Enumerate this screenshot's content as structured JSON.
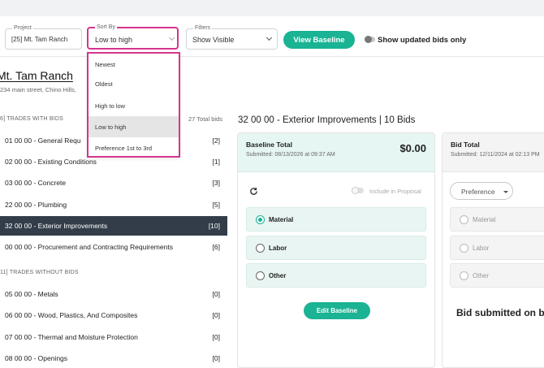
{
  "toolbar": {
    "project": {
      "legend": "Project",
      "value": "[25] Mt. Tam Ranch"
    },
    "sort_by": {
      "legend": "Sort By",
      "value": "Low to high"
    },
    "filters": {
      "legend": "Filters",
      "value": "Show Visible"
    },
    "view_baseline_label": "View Baseline",
    "show_updated_label": "Show updated bids only"
  },
  "sort_dropdown": {
    "options": [
      "Newest",
      "Oldest",
      "High to low",
      "Low to high",
      "Preference 1st to 3rd"
    ],
    "selected": "Low to high"
  },
  "project": {
    "title": "Mt. Tam Ranch",
    "address": "234 main street, Chino Hills,"
  },
  "sidebar": {
    "with_bids_heading": "6] TRADES WITH BIDS",
    "total_bids": "27 Total bids",
    "with_bids": [
      {
        "name": "01 00 00 - General Requ",
        "count": "[2]"
      },
      {
        "name": "02 00 00 - Existing Conditions",
        "count": "[1]"
      },
      {
        "name": "03 00 00 - Concrete",
        "count": "[3]"
      },
      {
        "name": "22 00 00 - Plumbing",
        "count": "[5]"
      },
      {
        "name": "32 00 00 - Exterior Improvements",
        "count": "[10]"
      },
      {
        "name": "00 00 00 - Procurement and Contracting Requirements",
        "count": "[6]"
      }
    ],
    "without_bids_heading": "11] TRADES WITHOUT BIDS",
    "without_bids": [
      {
        "name": "05 00 00 - Metals",
        "count": "[0]"
      },
      {
        "name": "06 00 00 - Wood, Plastics, And Composites",
        "count": "[0]"
      },
      {
        "name": "07 00 00 - Thermal and Moisture Protection",
        "count": "[0]"
      },
      {
        "name": "08 00 00 - Openings",
        "count": "[0]"
      }
    ]
  },
  "main": {
    "title": "32 00 00 - Exterior Improvements | 10 Bids",
    "baseline_card": {
      "title": "Baseline Total",
      "submitted": "Submitted: 08/13/2026 at 09:37 AM",
      "amount": "$0.00",
      "include_label": "Include in Proposal",
      "options": [
        "Material",
        "Labor",
        "Other"
      ],
      "selected_option": "Material",
      "edit_label": "Edit Baseline"
    },
    "bid_card": {
      "title": "Bid Total",
      "submitted": "Submitted: 12/11/2024 at 02:13 PM",
      "preference_label": "Preference",
      "options": [
        "Material",
        "Labor",
        "Other"
      ],
      "submitted_text": "Bid submitted on b"
    }
  },
  "colors": {
    "accent": "#1ab394",
    "highlight": "#d4358f",
    "active_row": "#333d4a"
  }
}
